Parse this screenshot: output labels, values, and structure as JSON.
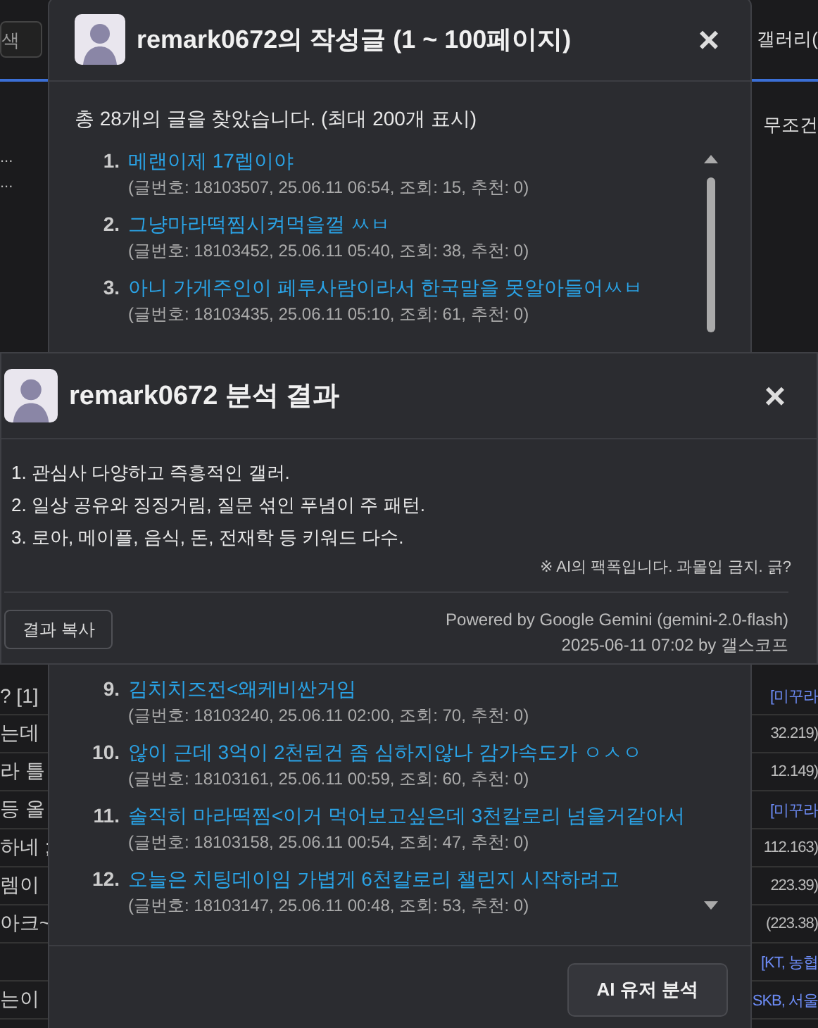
{
  "page": {
    "search_placeholder": "색",
    "gallery_label": "갤러리(",
    "notice": "무조건",
    "dots": [
      "...",
      "..."
    ],
    "rows": [
      {
        "left": "? [1]",
        "right": "[미꾸라",
        "color": "#6d8cf7"
      },
      {
        "left": "는데",
        "right": "32.219)",
        "color": "#bbbbbb"
      },
      {
        "left": "라 틀",
        "right": "12.149)",
        "color": "#bbbbbb"
      },
      {
        "left": "등 올",
        "right": "[미꾸라",
        "color": "#6d8cf7"
      },
      {
        "left": "하네 ;",
        "right": "112.163)",
        "color": "#bbbbbb"
      },
      {
        "left": "렘이",
        "right": "223.39)",
        "color": "#bbbbbb"
      },
      {
        "left": "아크~",
        "right": "(223.38)",
        "color": "#bbbbbb"
      },
      {
        "left": "",
        "right": "[KT, 농협",
        "color": "#6d8cf7"
      },
      {
        "left": "는이",
        "right": "SKB, 서울",
        "color": "#6d8cf7"
      }
    ]
  },
  "posts_dialog": {
    "title": "remark0672의 작성글 (1 ~ 100페이지)",
    "close": "×",
    "summary": "총 28개의 글을 찾았습니다. (최대 200개 표시)",
    "posts_top": [
      {
        "number": "1.",
        "title": "메랜이제 17렙이야",
        "meta": "(글번호: 18103507, 25.06.11 06:54, 조회: 15, 추천: 0)"
      },
      {
        "number": "2.",
        "title": "그냥마라떡찜시켜먹을껄 ㅆㅂ",
        "meta": "(글번호: 18103452, 25.06.11 05:40, 조회: 38, 추천: 0)"
      },
      {
        "number": "3.",
        "title": "아니 가게주인이 페루사람이라서 한국말을 못알아들어ㅆㅂ",
        "meta": "(글번호: 18103435, 25.06.11 05:10, 조회: 61, 추천: 0)"
      }
    ],
    "posts_bottom": [
      {
        "number": "9.",
        "title": "김치치즈전<왜케비싼거임",
        "meta": "(글번호: 18103240, 25.06.11 02:00, 조회: 70, 추천: 0)"
      },
      {
        "number": "10.",
        "title": "않이 근데 3억이 2천된건 좀 심하지않나 감가속도가 ㅇㅅㅇ",
        "meta": "(글번호: 18103161, 25.06.11 00:59, 조회: 60, 추천: 0)"
      },
      {
        "number": "11.",
        "title": "솔직히 마라떡찜<이거 먹어보고싶은데 3천칼로리 넘을거같아서",
        "meta": "(글번호: 18103158, 25.06.11 00:54, 조회: 47, 추천: 0)"
      },
      {
        "number": "12.",
        "title": "오늘은 치팅데이임 가볍게 6천칼로리 챌린지 시작하려고",
        "meta": "(글번호: 18103147, 25.06.11 00:48, 조회: 53, 추천: 0)"
      }
    ],
    "analyze_button": "AI 유저 분석"
  },
  "analysis_dialog": {
    "title": "remark0672 분석 결과",
    "close": "×",
    "lines": [
      "1. 관심사 다양하고 즉흥적인 갤러.",
      "2. 일상 공유와 징징거림, 질문 섞인 푸념이 주 패턴.",
      "3. 로아, 메이플, 음식, 돈, 전재학 등 키워드 다수."
    ],
    "note": "※ AI의 팩폭입니다. 과몰입 금지. 긁?",
    "copy_button": "결과 복사",
    "powered": "Powered by Google Gemini (gemini-2.0-flash)",
    "stamp": "2025-06-11 07:02 by 갤스코프"
  }
}
